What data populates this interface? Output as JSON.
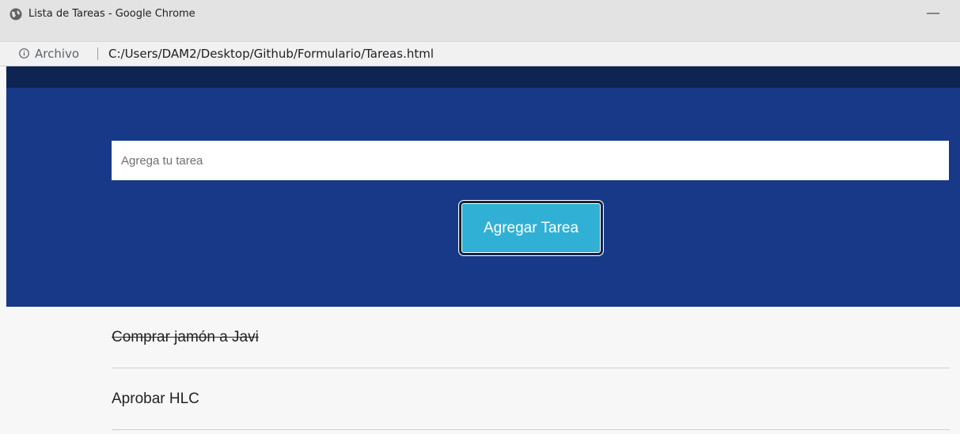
{
  "window": {
    "title": "Lista de Tareas - Google Chrome",
    "minimize_glyph": "—"
  },
  "address_bar": {
    "security_label": "Archivo",
    "url": "C:/Users/DAM2/Desktop/Github/Formulario/Tareas.html",
    "info_icon": "info-circle-icon",
    "page_icon": "globe-icon"
  },
  "form": {
    "input_placeholder": "Agrega tu tarea",
    "input_value": "",
    "button_label": "Agregar Tarea"
  },
  "tasks": [
    {
      "text": "Comprar jamón a Javi",
      "done": true
    },
    {
      "text": "Aprobar HLC",
      "done": false
    }
  ],
  "colors": {
    "hero_background": "#173988",
    "header_strip": "#0e2553",
    "button_background": "#31b0d5",
    "page_background": "#f7f7f7"
  }
}
